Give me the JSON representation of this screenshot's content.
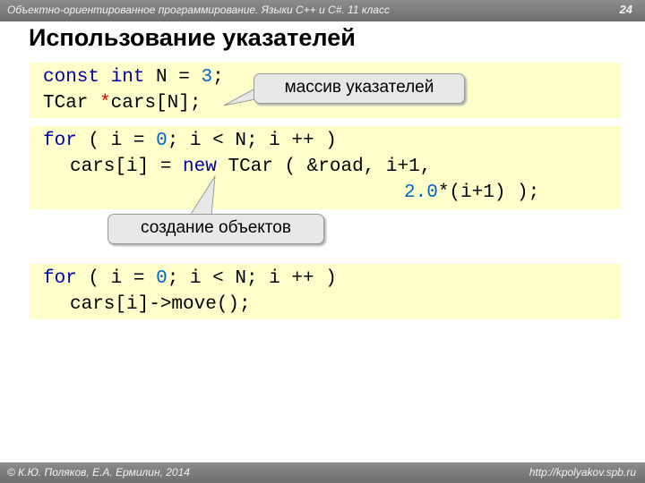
{
  "header": {
    "course": "Объектно-ориентированное программирование. Языки C++ и C#. 11 класс",
    "page_number": "24"
  },
  "title": "Использование указателей",
  "block1": {
    "l1_kw1": "const",
    "l1_kw2": "int",
    "l1_name": "N",
    "l1_eq": "=",
    "l1_num": "3",
    "l1_end": ";",
    "l2_type": "TCar",
    "l2_star": "*",
    "l2_rest": "cars[N];"
  },
  "callout_array": "массив указателей",
  "block2": {
    "l1_for": "for",
    "l1_open": "(",
    "l1_i": "i",
    "l1_eq": "=",
    "l1_zero": "0",
    "l1_semi": ";",
    "l1_i2": "i",
    "l1_lt": "<",
    "l1_n": "N;",
    "l1_inc": "i ++",
    "l1_close": ")",
    "l2_lhs": "cars[i]",
    "l2_eq": "=",
    "l2_new": "new",
    "l2_rest": "TCar ( &road, i+1,",
    "l3_num": "2.0",
    "l3_rest": "*(i+1) );"
  },
  "callout_objects": "создание объектов",
  "block3": {
    "l1_for": "for",
    "l1_open": "(",
    "l1_i": "i",
    "l1_eq": "=",
    "l1_zero": "0",
    "l1_semi": ";",
    "l1_i2": "i",
    "l1_lt": "<",
    "l1_n": "N;",
    "l1_inc": "i ++",
    "l1_close": ")",
    "l2": "cars[i]->move();"
  },
  "footer": {
    "authors": "© К.Ю. Поляков, Е.А. Ермилин, 2014",
    "site": "http://kpolyakov.spb.ru"
  },
  "colors": {
    "code_background": "#ffffcc",
    "keyword": "#0000aa",
    "number": "#0066cc",
    "pointer_star": "#cc0000",
    "bar": "#7d7d7d"
  }
}
